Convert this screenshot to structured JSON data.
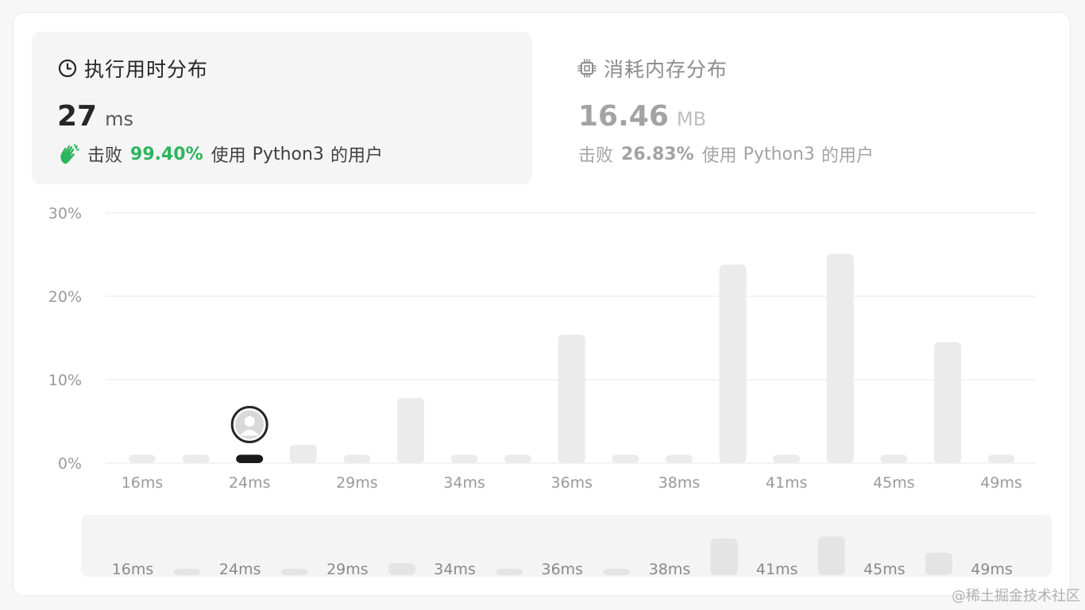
{
  "runtime": {
    "title": "执行用时分布",
    "value": "27",
    "unit": "ms",
    "beat_prefix": "击败",
    "beat_pct": "99.40%",
    "beat_suffix_a": "使用",
    "beat_lang": "Python3",
    "beat_suffix_b": "的用户",
    "icon": "clock-icon"
  },
  "memory": {
    "title": "消耗内存分布",
    "value": "16.46",
    "unit": "MB",
    "beat_prefix": "击败",
    "beat_pct": "26.83%",
    "beat_suffix_a": "使用",
    "beat_lang": "Python3",
    "beat_suffix_b": "的用户",
    "icon": "chip-icon"
  },
  "colors": {
    "accent_green": "#2db55d",
    "bar_default": "#ebebeb",
    "bar_selected": "#1a1a1a",
    "grid": "#ececec",
    "tick_text": "#9a9a9a"
  },
  "chart_data": {
    "type": "bar",
    "ylim": [
      0,
      30
    ],
    "y_ticks": [
      "0%",
      "10%",
      "20%",
      "30%"
    ],
    "x_tick_labels": [
      "16ms",
      "24ms",
      "29ms",
      "34ms",
      "36ms",
      "38ms",
      "41ms",
      "45ms",
      "49ms"
    ],
    "values": [
      1.0,
      1.0,
      1.0,
      2.2,
      1.0,
      7.8,
      1.0,
      1.0,
      15.4,
      1.0,
      1.0,
      23.8,
      1.0,
      25.1,
      1.0,
      14.5,
      1.0
    ],
    "selected_index": 2,
    "selected_label": "24ms"
  },
  "overview": {
    "x_tick_labels": [
      "16ms",
      "24ms",
      "29ms",
      "34ms",
      "36ms",
      "38ms",
      "41ms",
      "45ms",
      "49ms"
    ]
  },
  "watermark": "@稀土掘金技术社区"
}
